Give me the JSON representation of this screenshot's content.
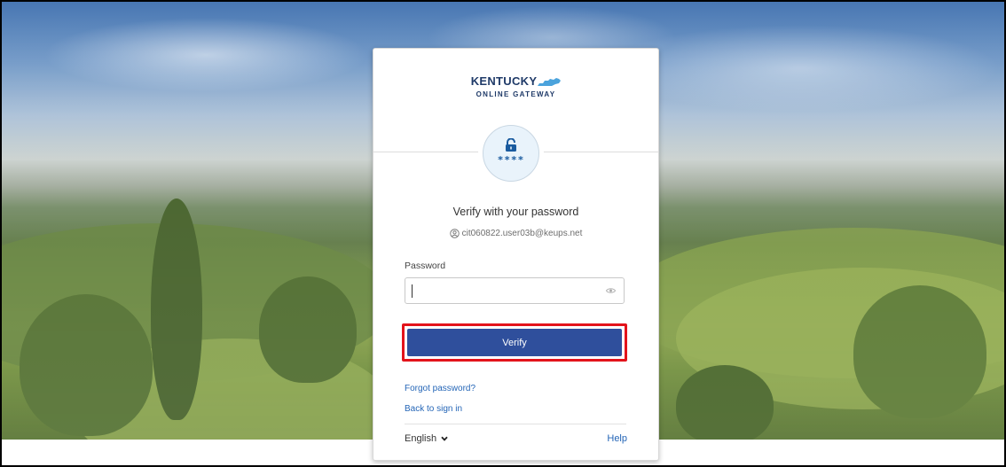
{
  "brand": {
    "name_line1": "KENTUCKY",
    "name_line2": "ONLINE GATEWAY"
  },
  "auth_badge": {
    "icon": "unlocked-padlock-icon",
    "masked_text": "****"
  },
  "login": {
    "title": "Verify with your password",
    "user_icon": "user-circle-icon",
    "username": "cit060822.user03b@keups.net",
    "password_label": "Password",
    "password_value": "",
    "reveal_icon": "eye-icon",
    "verify_label": "Verify"
  },
  "links": {
    "forgot_password": "Forgot password?",
    "back_to_sign_in": "Back to sign in"
  },
  "footer": {
    "language": "English",
    "language_icon": "chevron-down-icon",
    "help": "Help"
  },
  "colors": {
    "primary_button": "#2f4f9c",
    "highlight_outline": "#e3131b",
    "link": "#2566b7",
    "brand_text": "#1f3a68",
    "brand_shape": "#4ba3dc"
  }
}
